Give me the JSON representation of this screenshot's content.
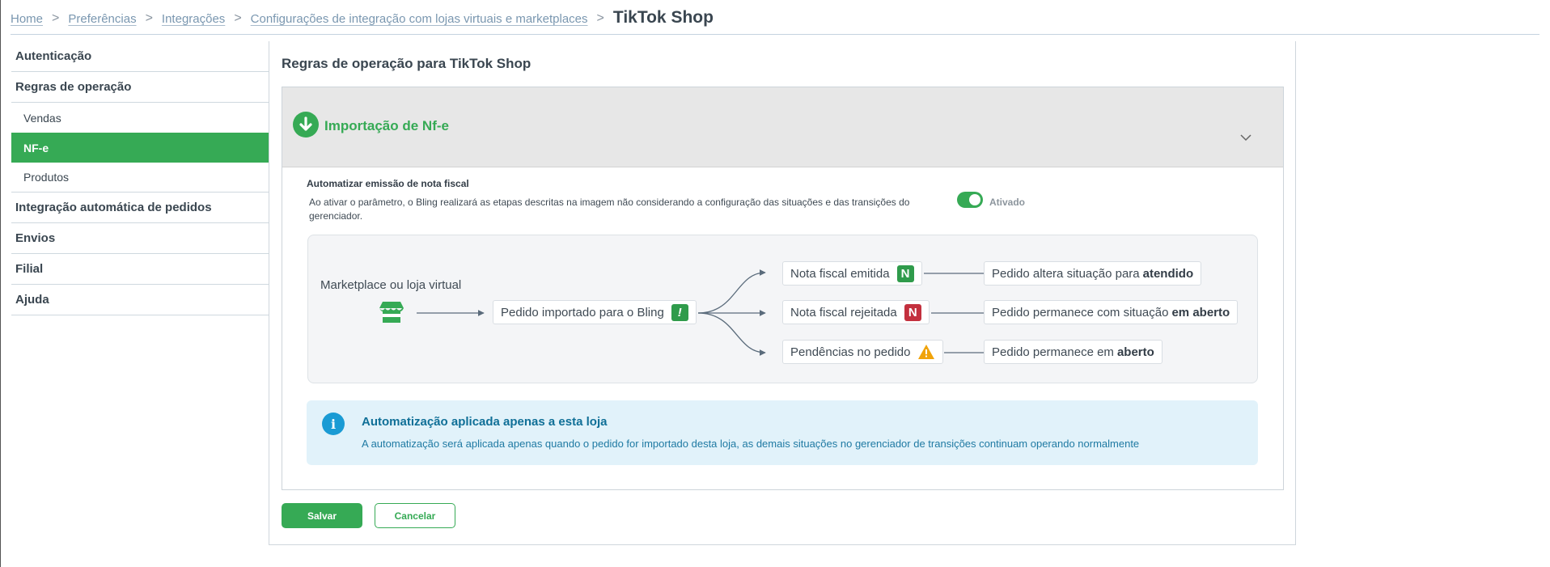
{
  "breadcrumb": {
    "items": [
      "Home",
      "Preferências",
      "Integrações",
      "Configurações de integração com lojas virtuais e marketplaces"
    ],
    "current": "TikTok Shop",
    "separator": ">"
  },
  "sidebar": {
    "items": [
      {
        "label": "Autenticação"
      },
      {
        "label": "Regras de operação"
      },
      {
        "label": "Vendas"
      },
      {
        "label": "NF-e",
        "active": true
      },
      {
        "label": "Produtos"
      },
      {
        "label": "Integração automática de pedidos"
      },
      {
        "label": "Envios"
      },
      {
        "label": "Filial"
      },
      {
        "label": "Ajuda"
      }
    ]
  },
  "main": {
    "title": "Regras de operação para TikTok Shop",
    "section": {
      "title": "Importação de Nf-e",
      "icon": "download-circle-icon",
      "expanded_icon": "chevron-down-icon"
    },
    "automation": {
      "label": "Automatizar emissão de nota fiscal",
      "description": "Ao ativar o parâmetro, o Bling realizará as etapas descritas na imagem não considerando a configuração das situações e das transições do gerenciador.",
      "toggle_on": true,
      "toggle_label": "Ativado"
    },
    "flow": {
      "source_label": "Marketplace ou loja virtual",
      "source_icon": "store-icon",
      "imported": {
        "text": "Pedido importado para o Bling",
        "badge": "!"
      },
      "branches": [
        {
          "status": "Nota fiscal emitida",
          "badge": "N",
          "badge_color": "#2f9b4b",
          "result_prefix": "Pedido altera situação para",
          "result_bold": "atendido"
        },
        {
          "status": "Nota fiscal rejeitada",
          "badge": "N",
          "badge_color": "#c3303e",
          "result_prefix": "Pedido permanece com situação",
          "result_bold": "em aberto"
        },
        {
          "status": "Pendências no pedido",
          "badge_icon": "warning-icon",
          "badge_color": "#f0a30a",
          "result_prefix": "Pedido permanece em",
          "result_bold": "aberto"
        }
      ]
    },
    "info": {
      "title": "Automatização aplicada apenas a esta loja",
      "text": "A automatização será aplicada apenas quando o pedido for importado desta loja, as demais situações no gerenciador de transições continuam operando normalmente",
      "icon": "info-icon"
    }
  },
  "actions": {
    "save_label": "Salvar",
    "cancel_label": "Cancelar"
  },
  "colors": {
    "accent": "#36aa55",
    "info": "#1a9bd4",
    "danger": "#c3303e",
    "warning": "#f0a30a"
  }
}
